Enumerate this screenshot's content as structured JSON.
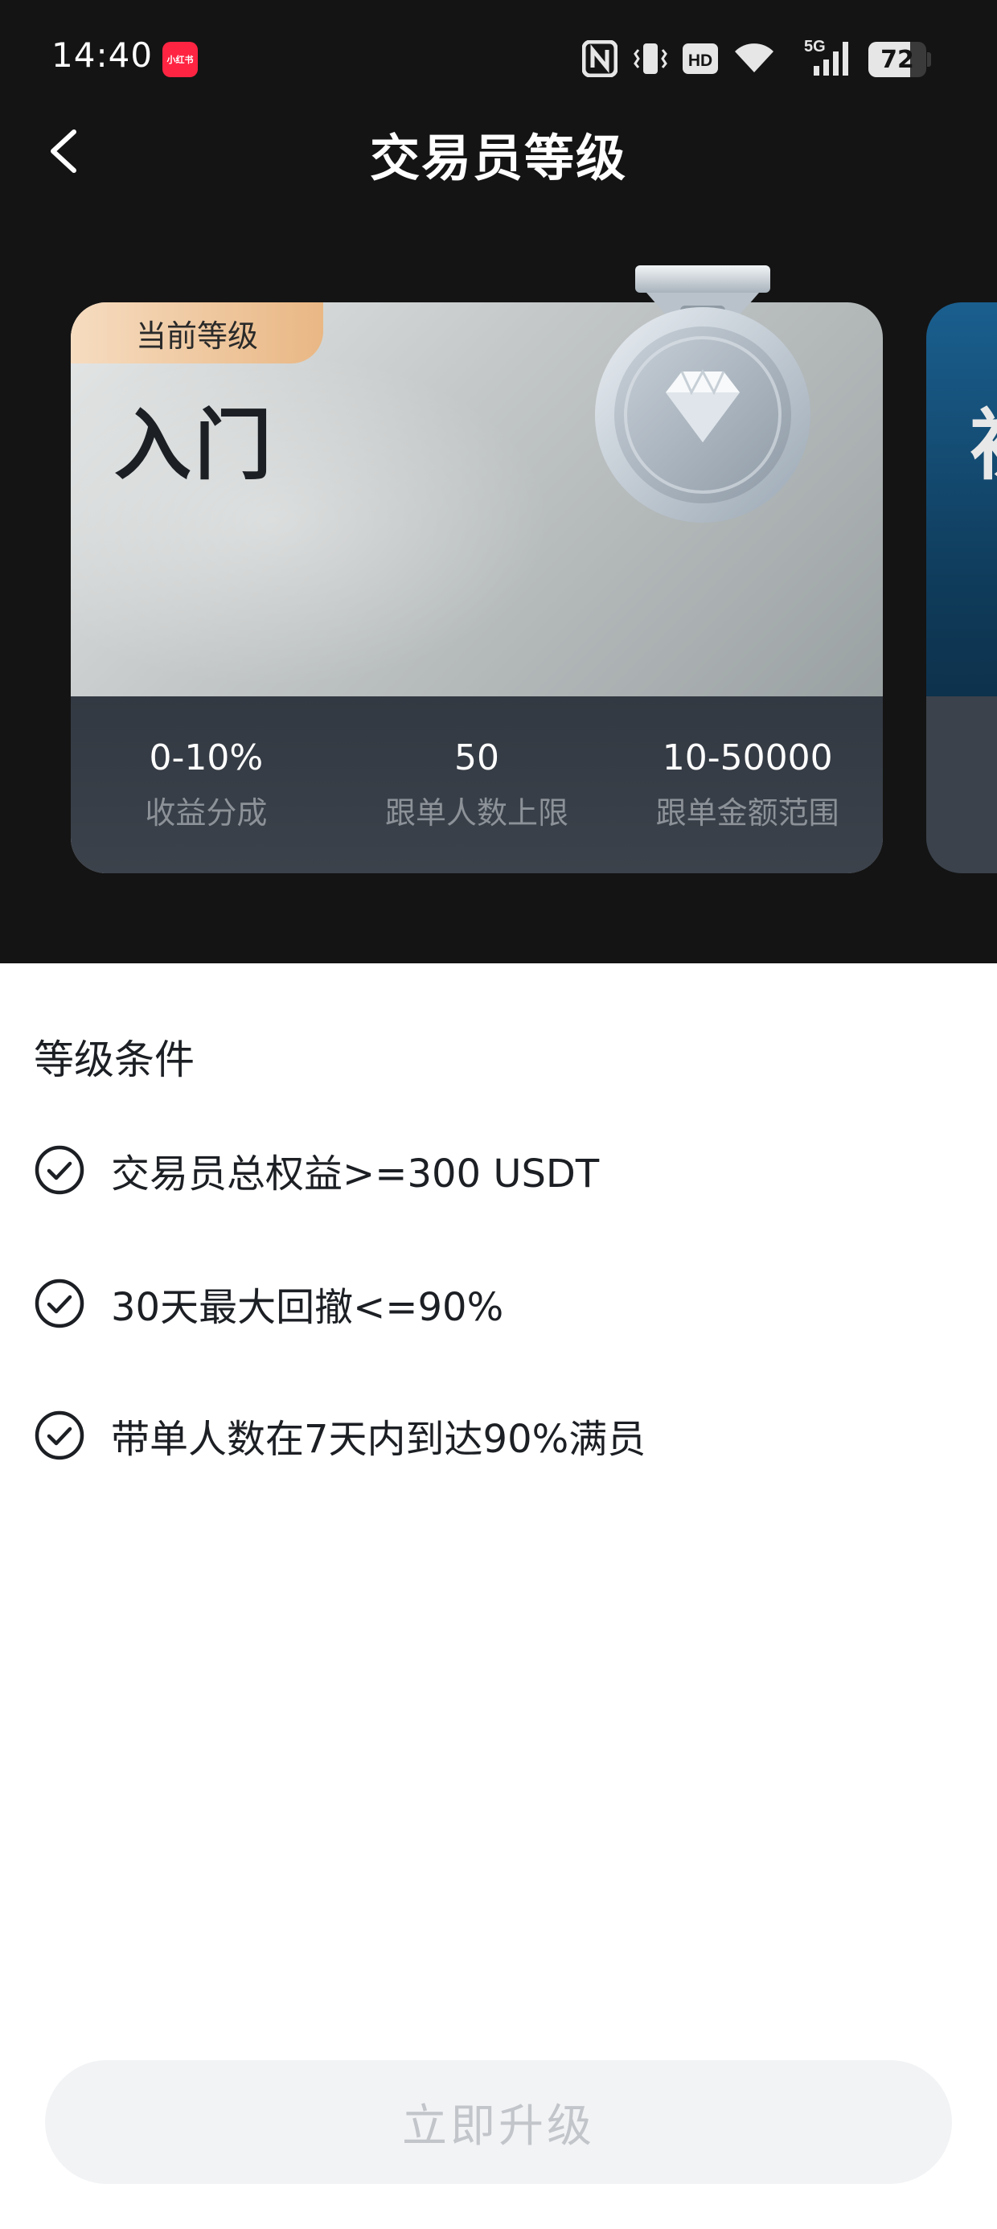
{
  "status_bar": {
    "time": "14:40",
    "app_badge": "小红书",
    "battery": "72",
    "battery_level": 0.72,
    "network": "5G",
    "icons": [
      "nfc-icon",
      "vibrate-icon",
      "hd-icon",
      "wifi-icon",
      "signal-5g-icon",
      "battery-icon"
    ]
  },
  "header": {
    "title": "交易员等级",
    "back_icon": "chevron-left-icon"
  },
  "card": {
    "tag": "当前等级",
    "level": "入门",
    "medal_icon": "diamond-medal-icon",
    "stats": [
      {
        "value": "0-10%",
        "label": "收益分成"
      },
      {
        "value": "50",
        "label": "跟单人数上限"
      },
      {
        "value": "10-50000",
        "label": "跟单金额范围"
      }
    ]
  },
  "next_card": {
    "peek_char": "初"
  },
  "conditions": {
    "title": "等级条件",
    "items": [
      {
        "text": "交易员总权益>=300 USDT",
        "icon": "check-circle-icon"
      },
      {
        "text": "30天最大回撤<=90%",
        "icon": "check-circle-icon"
      },
      {
        "text": "带单人数在7天内到达90%满员",
        "icon": "check-circle-icon"
      }
    ]
  },
  "upgrade_button": {
    "label": "立即升级",
    "state": "disabled"
  },
  "colors": {
    "background_dark": "#141414",
    "tag_gradient_start": "#f6dcc0",
    "tag_gradient_end": "#e9b784",
    "stats_bg": "#333942",
    "button_bg": "#f2f3f5",
    "button_text": "#c2c5ca"
  }
}
